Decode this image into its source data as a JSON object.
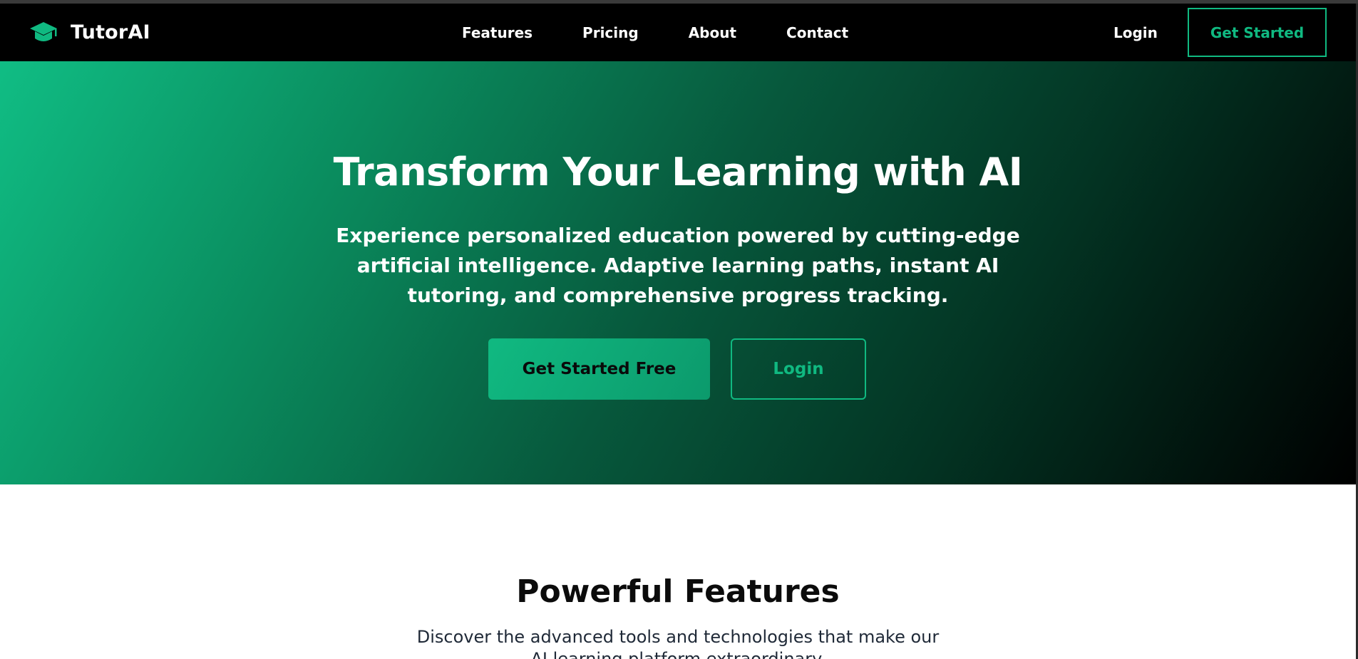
{
  "nav": {
    "brand": "TutorAI",
    "brand_icon": "graduation-cap-icon",
    "links": [
      "Features",
      "Pricing",
      "About",
      "Contact"
    ],
    "login": "Login",
    "cta": "Get Started"
  },
  "hero": {
    "title": "Transform Your Learning with AI",
    "subtitle": "Experience personalized education powered by cutting-edge artificial intelligence. Adaptive learning paths, instant AI tutoring, and comprehensive progress tracking.",
    "primary_button": "Get Started Free",
    "secondary_button": "Login"
  },
  "features": {
    "title": "Powerful Features",
    "subtitle": "Discover the advanced tools and technologies that make our AI learning platform extraordinary."
  },
  "colors": {
    "accent": "#10b981",
    "nav_bg": "#000000",
    "hero_gradient_start": "#10bd84",
    "hero_gradient_end": "#000000"
  }
}
